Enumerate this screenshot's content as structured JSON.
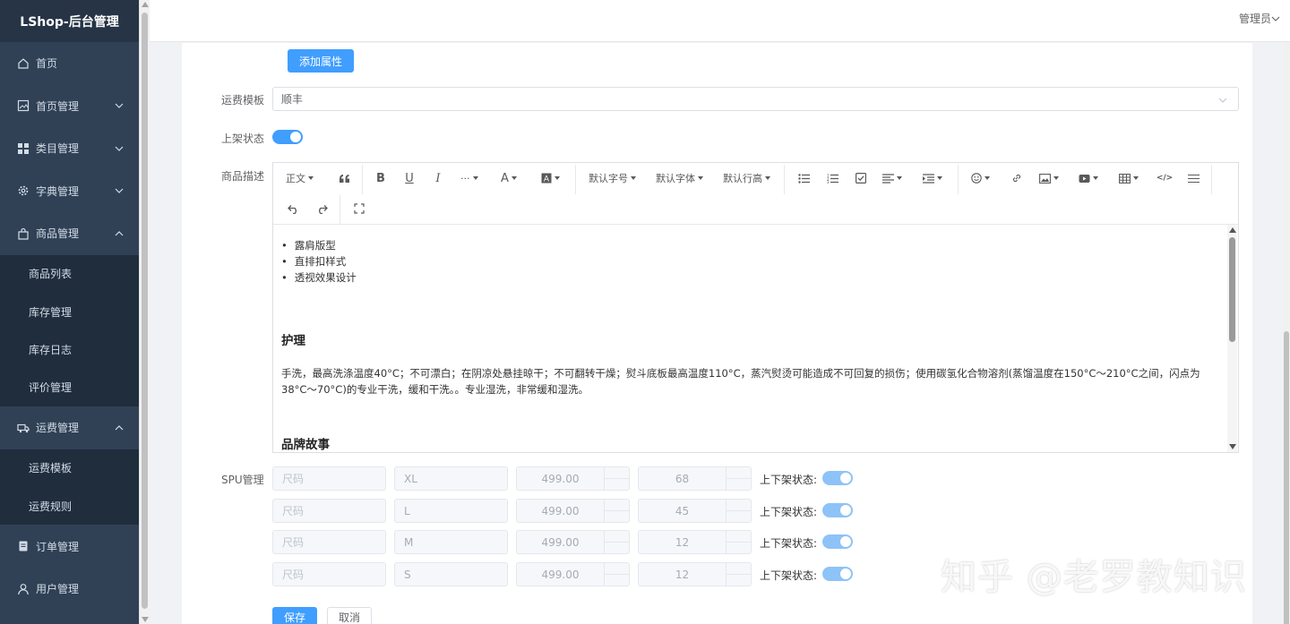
{
  "app": {
    "brand": "LShop-后台管理",
    "user": "管理员"
  },
  "sidebar": {
    "items": [
      {
        "label": "首页",
        "icon": "home-icon"
      },
      {
        "label": "首页管理",
        "icon": "image-icon"
      },
      {
        "label": "类目管理",
        "icon": "grid-icon"
      },
      {
        "label": "字典管理",
        "icon": "gear-icon"
      },
      {
        "label": "商品管理",
        "icon": "bag-icon"
      },
      {
        "label": "商品列表"
      },
      {
        "label": "库存管理"
      },
      {
        "label": "库存日志"
      },
      {
        "label": "评价管理"
      },
      {
        "label": "运费管理",
        "icon": "truck-icon"
      },
      {
        "label": "运费模板"
      },
      {
        "label": "运费规则"
      },
      {
        "label": "订单管理",
        "icon": "order-icon"
      },
      {
        "label": "用户管理",
        "icon": "user-icon"
      }
    ]
  },
  "form": {
    "add_attr_button": "添加属性",
    "freight_label": "运费模板",
    "freight_value": "顺丰",
    "listing_label": "上架状态",
    "listing_on": true,
    "desc_label": "商品描述",
    "spu_label": "SPU管理",
    "save_button": "保存",
    "cancel_button": "取消"
  },
  "editor": {
    "toolbar": {
      "paragraph": "正文",
      "font_size": "默认字号",
      "font_family": "默认字体",
      "line_height": "默认行高"
    },
    "bullets": [
      "露肩版型",
      "直排扣样式",
      "透视效果设计"
    ],
    "heading1": "护理",
    "care_text": "手洗，最高洗涤温度40°C；不可漂白；在阴凉处悬挂晾干；不可翻转干燥；熨斗底板最高温度110°C，蒸汽熨烫可能造成不可回复的损伤；使用碳氢化合物溶剂(蒸馏温度在150°C～210°C之间，闪点为38°C～70°C)的专业干洗，缓和干洗。。专业湿洗，非常缓和湿洗。",
    "heading2": "品牌故事"
  },
  "spu": {
    "status_label": "上下架状态:",
    "rows": [
      {
        "attr": "尺码",
        "value": "XL",
        "price": "499.00",
        "stock": "68"
      },
      {
        "attr": "尺码",
        "value": "L",
        "price": "499.00",
        "stock": "45"
      },
      {
        "attr": "尺码",
        "value": "M",
        "price": "499.00",
        "stock": "12"
      },
      {
        "attr": "尺码",
        "value": "S",
        "price": "499.00",
        "stock": "12"
      }
    ]
  },
  "watermark": "知乎 @老罗教知识",
  "colors": {
    "primary": "#409eff",
    "sidebar": "#304156",
    "submenu": "#1f2d3d"
  }
}
